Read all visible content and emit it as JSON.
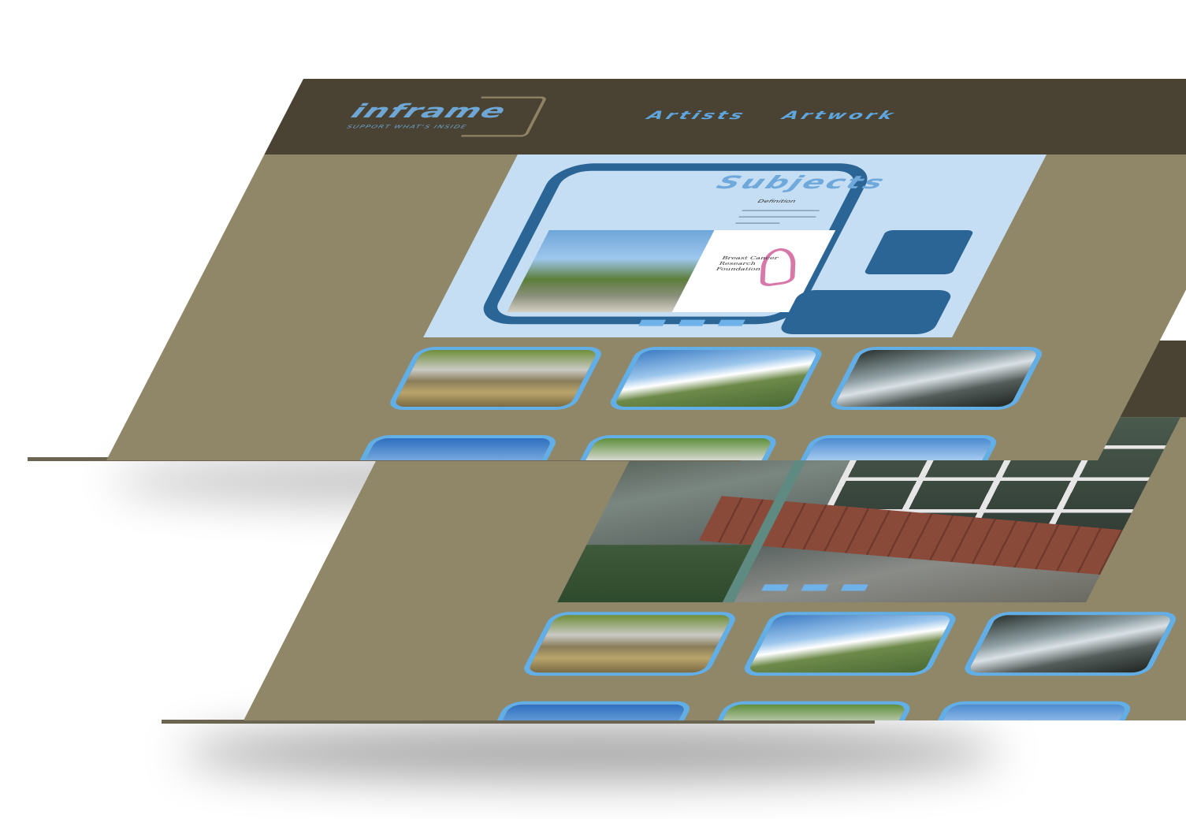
{
  "site": {
    "logo_text": "inframe",
    "tagline": "SUPPORT WHAT'S INSIDE"
  },
  "nav": {
    "items": [
      {
        "label": "Artists"
      },
      {
        "label": "Artwork"
      }
    ]
  },
  "hero": {
    "title": "Subjects",
    "subtitle": "Definition",
    "sponsor_text": "Breast Cancer Research Foundation"
  },
  "thumbnails": [
    {
      "icon": "skateboard-photo"
    },
    {
      "icon": "hillside-sky-photo"
    },
    {
      "icon": "water-photo"
    },
    {
      "icon": "mountain-sky-photo"
    },
    {
      "icon": "skater-jump-photo"
    },
    {
      "icon": "field-photo"
    }
  ],
  "colors": {
    "header_bg": "#4a4334",
    "page_bg": "#908668",
    "accent_blue": "#5fa6df",
    "hero_bg": "#c5def3",
    "frame_blue": "#2b6596"
  }
}
